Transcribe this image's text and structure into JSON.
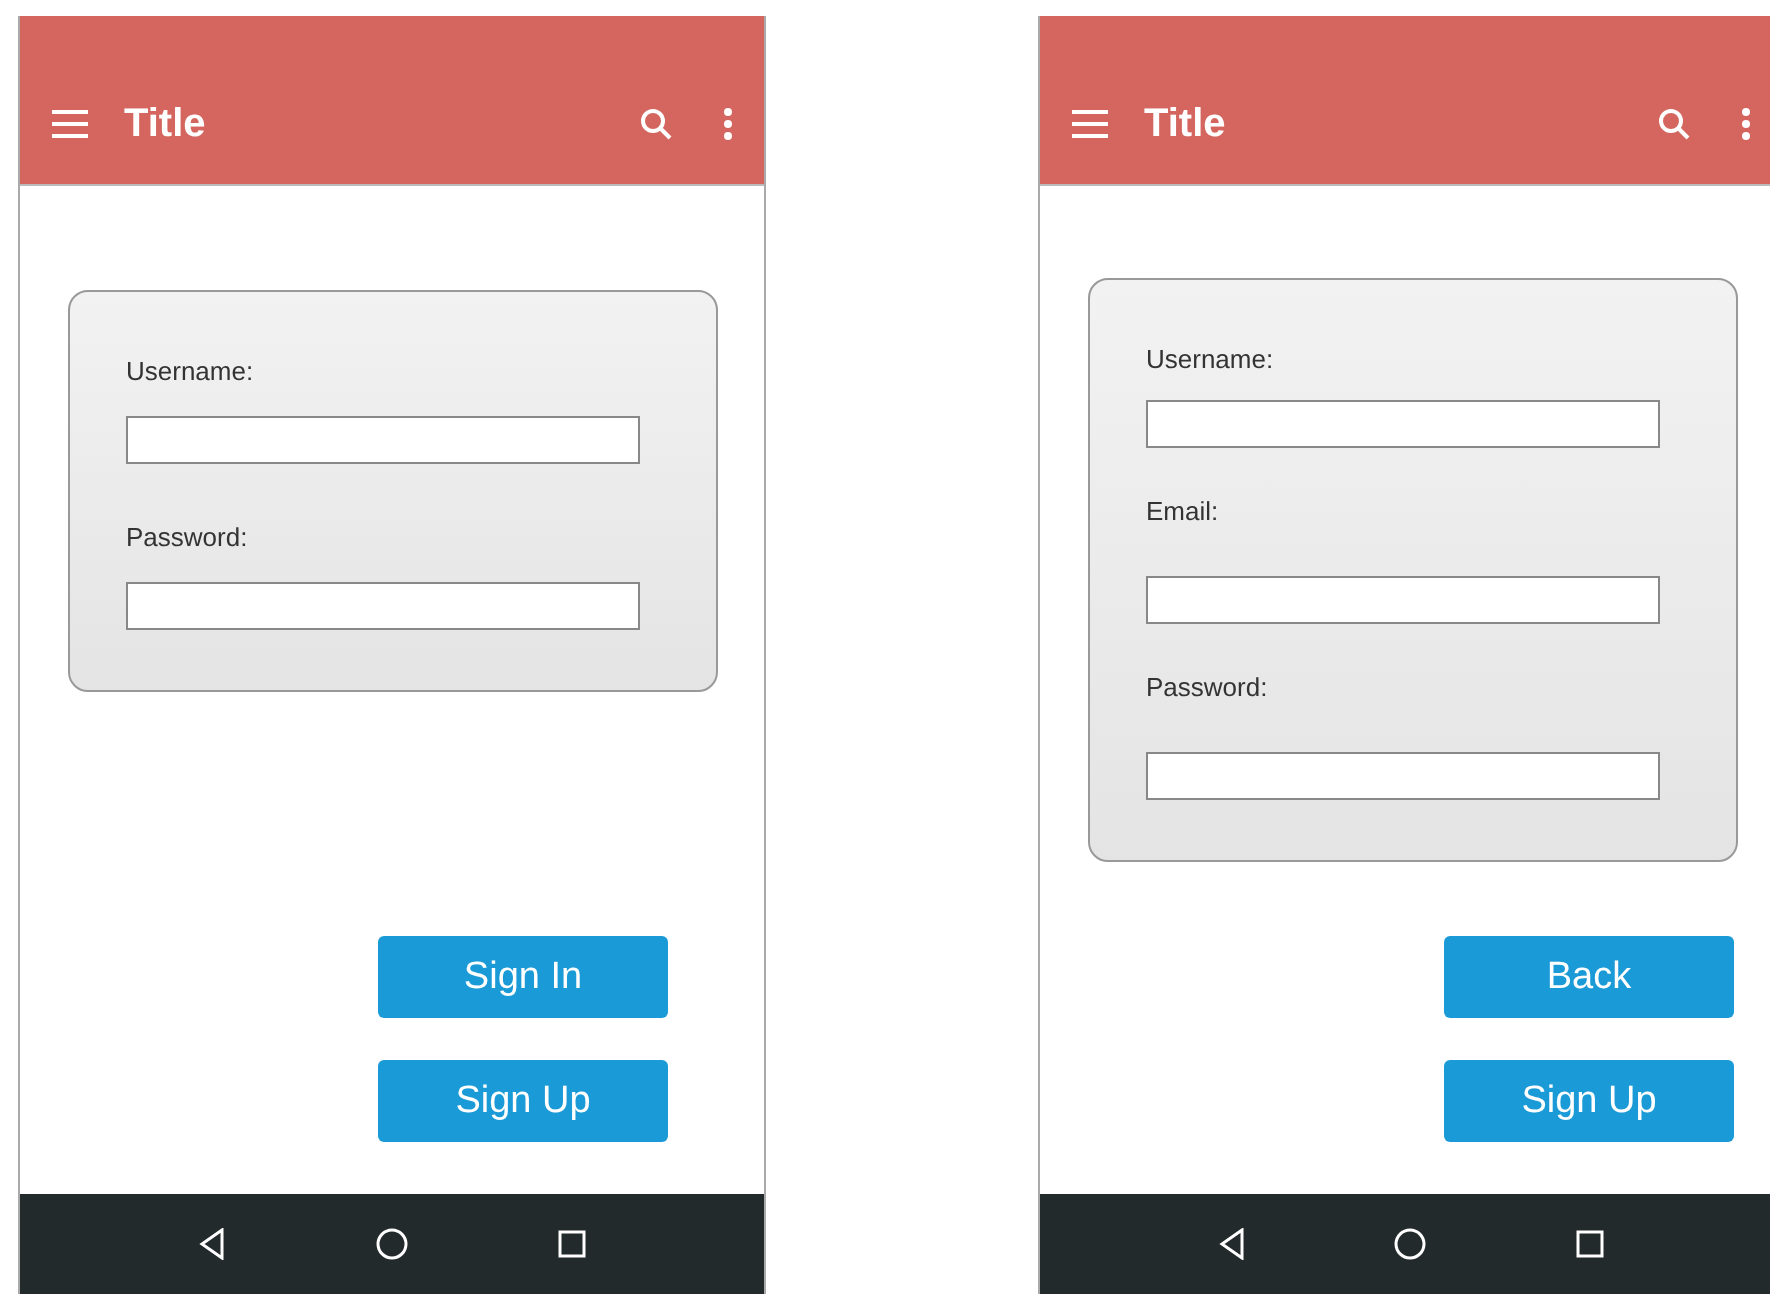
{
  "screens": [
    {
      "title": "Title",
      "fields": [
        {
          "label": "Username:"
        },
        {
          "label": "Password:"
        }
      ],
      "buttons": [
        "Sign In",
        "Sign Up"
      ]
    },
    {
      "title": "Title",
      "fields": [
        {
          "label": "Username:"
        },
        {
          "label": "Email:"
        },
        {
          "label": "Password:"
        }
      ],
      "buttons": [
        "Back",
        "Sign Up"
      ]
    }
  ]
}
